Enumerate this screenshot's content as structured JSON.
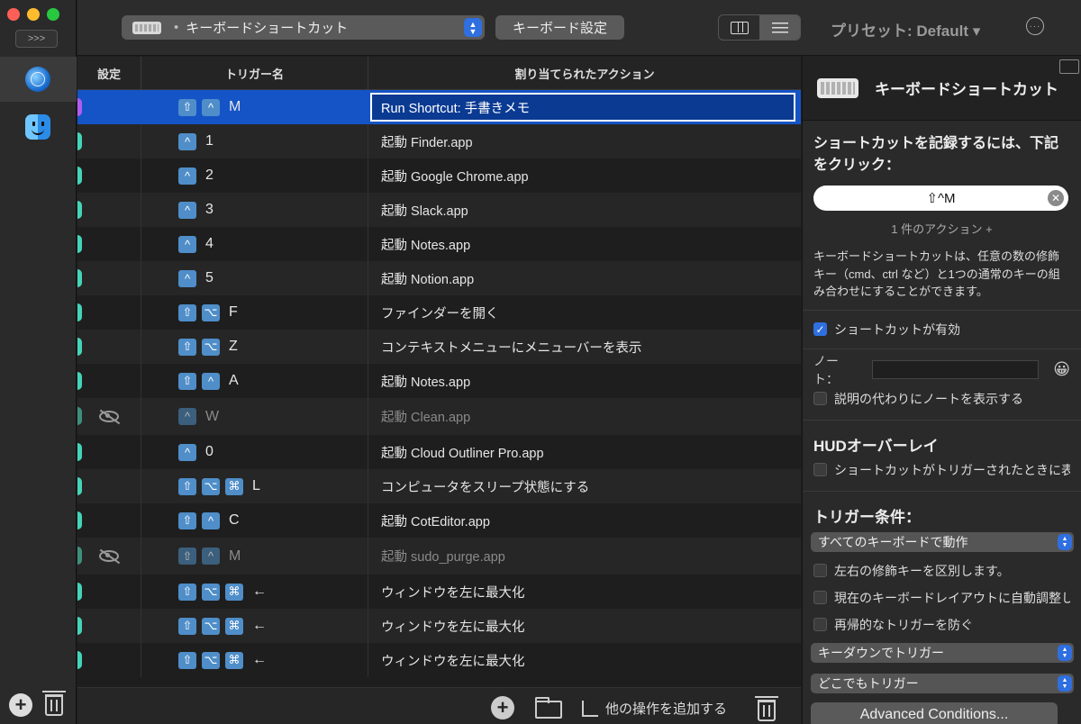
{
  "sidebar": {
    "expand_label": ">>>",
    "apps": [
      {
        "icon": "globe-icon",
        "selected": true
      },
      {
        "icon": "finder-icon",
        "selected": false
      }
    ]
  },
  "toolbar": {
    "trigger_type": "キーボードショートカット",
    "trigger_dot": "•",
    "keyboard_settings_label": "キーボード設定",
    "preset_label": "プリセット: Default ▾",
    "more_label": "···"
  },
  "table": {
    "columns": [
      "設定",
      "トリガー名",
      "割り当てられたアクション"
    ],
    "rows": [
      {
        "keys": [
          "⇧",
          "^"
        ],
        "char": "M",
        "action": "Run Shortcut: 手書きメモ",
        "selected": true,
        "disabled": false
      },
      {
        "keys": [
          "^"
        ],
        "char": "1",
        "action": "起動 Finder.app",
        "selected": false,
        "disabled": false
      },
      {
        "keys": [
          "^"
        ],
        "char": "2",
        "action": "起動 Google Chrome.app",
        "selected": false,
        "disabled": false
      },
      {
        "keys": [
          "^"
        ],
        "char": "3",
        "action": "起動 Slack.app",
        "selected": false,
        "disabled": false
      },
      {
        "keys": [
          "^"
        ],
        "char": "4",
        "action": "起動 Notes.app",
        "selected": false,
        "disabled": false
      },
      {
        "keys": [
          "^"
        ],
        "char": "5",
        "action": "起動 Notion.app",
        "selected": false,
        "disabled": false
      },
      {
        "keys": [
          "⇧",
          "⌥"
        ],
        "char": "F",
        "action": "ファインダーを開く",
        "selected": false,
        "disabled": false
      },
      {
        "keys": [
          "⇧",
          "⌥"
        ],
        "char": "Z",
        "action": "コンテキストメニューにメニューバーを表示",
        "selected": false,
        "disabled": false
      },
      {
        "keys": [
          "⇧",
          "^"
        ],
        "char": "A",
        "action": "起動 Notes.app",
        "selected": false,
        "disabled": false
      },
      {
        "keys": [
          "^"
        ],
        "char": "W",
        "action": "起動 Clean.app",
        "selected": false,
        "disabled": true
      },
      {
        "keys": [
          "^"
        ],
        "char": "0",
        "action": "起動 Cloud Outliner Pro.app",
        "selected": false,
        "disabled": false
      },
      {
        "keys": [
          "⇧",
          "⌥",
          "⌘"
        ],
        "char": "L",
        "action": "コンピュータをスリープ状態にする",
        "selected": false,
        "disabled": false
      },
      {
        "keys": [
          "⇧",
          "^"
        ],
        "char": "C",
        "action": "起動 CotEditor.app",
        "selected": false,
        "disabled": false
      },
      {
        "keys": [
          "⇧",
          "^"
        ],
        "char": "M",
        "action": "起動 sudo_purge.app",
        "selected": false,
        "disabled": true
      },
      {
        "keys": [
          "⇧",
          "⌥",
          "⌘"
        ],
        "char": "←",
        "action": "ウィンドウを左に最大化",
        "selected": false,
        "disabled": false
      },
      {
        "keys": [
          "⇧",
          "⌥",
          "⌘"
        ],
        "char": "←",
        "action": "ウィンドウを左に最大化",
        "selected": false,
        "disabled": false
      },
      {
        "keys": [
          "⇧",
          "⌥",
          "⌘"
        ],
        "char": "←",
        "action": "ウィンドウを左に最大化",
        "selected": false,
        "disabled": false
      }
    ]
  },
  "footer": {
    "add_other_label": "他の操作を追加する"
  },
  "inspector": {
    "title": "キーボードショートカット",
    "record_title": "ショートカットを記録するには、下記をクリック：",
    "recorded_shortcut": "⇧^M",
    "action_count": "1 件のアクション +",
    "description": "キーボードショートカットは、任意の数の修飾キー（cmd、ctrl など）と1つの通常のキーの組み合わせにすることができます。",
    "enabled_label": "ショートカットが有効",
    "note_label": "ノート：",
    "note_value": "",
    "emoji": "😀",
    "show_note_label": "説明の代わりにノートを表示する",
    "hud_title": "HUDオーバーレイ",
    "hud_label": "ショートカットがトリガーされたときに表示",
    "trigger_conditions_title": "トリガー条件：",
    "keyboard_select": "すべてのキーボードで動作",
    "distinguish_label": "左右の修飾キーを区別します。",
    "auto_adjust_label": "現在のキーボードレイアウトに自動調整し",
    "prevent_recursive_label": "再帰的なトリガーを防ぐ",
    "trigger_on_select": "キーダウンでトリガー",
    "trigger_where_select": "どこでもトリガー",
    "advanced_label": "Advanced Conditions..."
  },
  "colors": {
    "accent": "#2f6fe0",
    "selection": "#1554c6",
    "enabled_pill": "#45d4b7",
    "selected_pill": "#b15cf0",
    "key_badge": "#4f8ec9"
  }
}
